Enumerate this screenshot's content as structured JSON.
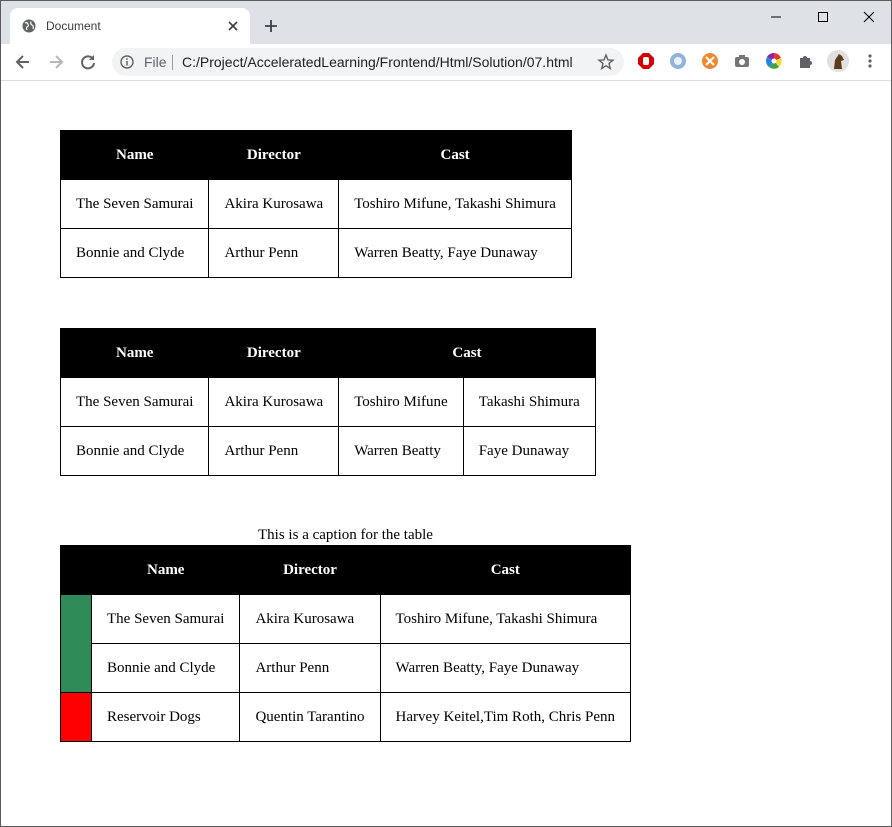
{
  "browser": {
    "tab_title": "Document",
    "file_label": "File",
    "url": "C:/Project/AcceleratedLearning/Frontend/Html/Solution/07.html"
  },
  "table1": {
    "headers": [
      "Name",
      "Director",
      "Cast"
    ],
    "rows": [
      [
        "The Seven Samurai",
        "Akira Kurosawa",
        "Toshiro Mifune, Takashi Shimura"
      ],
      [
        "Bonnie and Clyde",
        "Arthur Penn",
        "Warren Beatty, Faye Dunaway"
      ]
    ]
  },
  "table2": {
    "headers": [
      "Name",
      "Director",
      "Cast"
    ],
    "rows": [
      [
        "The Seven Samurai",
        "Akira Kurosawa",
        "Toshiro Mifune",
        "Takashi Shimura"
      ],
      [
        "Bonnie and Clyde",
        "Arthur Penn",
        "Warren Beatty",
        "Faye Dunaway"
      ]
    ]
  },
  "table3": {
    "caption": "This is a caption for the table",
    "headers": [
      "",
      "Name",
      "Director",
      "Cast"
    ],
    "rows": [
      [
        "The Seven Samurai",
        "Akira Kurosawa",
        "Toshiro Mifune, Takashi Shimura"
      ],
      [
        "Bonnie and Clyde",
        "Arthur Penn",
        "Warren Beatty, Faye Dunaway"
      ],
      [
        "Reservoir Dogs",
        "Quentin Tarantino",
        "Harvey Keitel,Tim Roth, Chris Penn"
      ]
    ],
    "colors": {
      "group_green": "#2e8b57",
      "group_red": "#ff0000"
    }
  }
}
